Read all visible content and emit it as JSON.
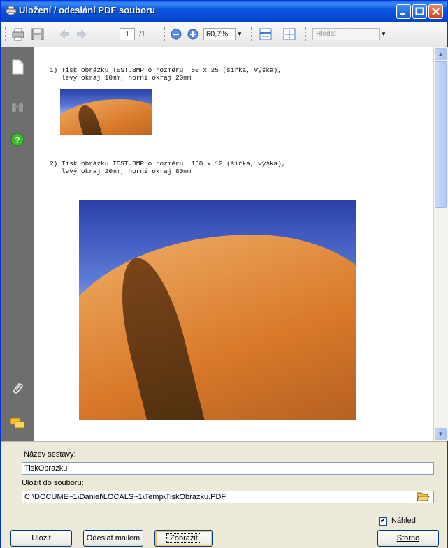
{
  "window": {
    "title": "Uložení / odeslání PDF souboru"
  },
  "toolbar": {
    "page_current": "1",
    "page_total": "/1",
    "zoom": "60,7%",
    "search_placeholder": "Hledat"
  },
  "document": {
    "item1_line1": "1) Tisk obrázku TEST.BMP o rozměru  50 x 25 (šířka, výška),",
    "item1_line2": "   levý okraj 10mm, horní okraj 20mm",
    "item2_line1": "2) Tisk obrázku TEST.BMP o rozměru  150 x 12 (šířka, výška),",
    "item2_line2": "   levý okraj 20mm, horní okraj 80mm"
  },
  "form": {
    "name_label": "Název sestavy:",
    "name_value": "TiskObrazku",
    "file_label": "Uložit do souboru:",
    "file_value": "C:\\DOCUME~1\\Daniel\\LOCALS~1\\Temp\\TiskObrazku.PDF",
    "preview_label": "Náhled",
    "preview_checked": "✔"
  },
  "buttons": {
    "save": "Uložit",
    "send_mail": "Odeslat mailem",
    "show": "Zobrazit",
    "cancel": "Storno"
  }
}
